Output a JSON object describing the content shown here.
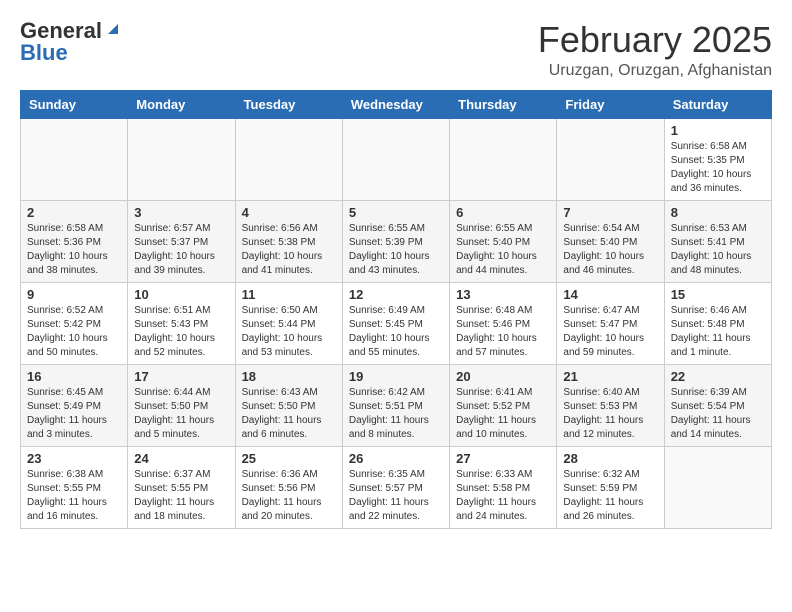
{
  "header": {
    "logo_general": "General",
    "logo_blue": "Blue",
    "month": "February 2025",
    "location": "Uruzgan, Oruzgan, Afghanistan"
  },
  "days_of_week": [
    "Sunday",
    "Monday",
    "Tuesday",
    "Wednesday",
    "Thursday",
    "Friday",
    "Saturday"
  ],
  "weeks": [
    [
      {
        "day": "",
        "info": ""
      },
      {
        "day": "",
        "info": ""
      },
      {
        "day": "",
        "info": ""
      },
      {
        "day": "",
        "info": ""
      },
      {
        "day": "",
        "info": ""
      },
      {
        "day": "",
        "info": ""
      },
      {
        "day": "1",
        "info": "Sunrise: 6:58 AM\nSunset: 5:35 PM\nDaylight: 10 hours\nand 36 minutes."
      }
    ],
    [
      {
        "day": "2",
        "info": "Sunrise: 6:58 AM\nSunset: 5:36 PM\nDaylight: 10 hours\nand 38 minutes."
      },
      {
        "day": "3",
        "info": "Sunrise: 6:57 AM\nSunset: 5:37 PM\nDaylight: 10 hours\nand 39 minutes."
      },
      {
        "day": "4",
        "info": "Sunrise: 6:56 AM\nSunset: 5:38 PM\nDaylight: 10 hours\nand 41 minutes."
      },
      {
        "day": "5",
        "info": "Sunrise: 6:55 AM\nSunset: 5:39 PM\nDaylight: 10 hours\nand 43 minutes."
      },
      {
        "day": "6",
        "info": "Sunrise: 6:55 AM\nSunset: 5:40 PM\nDaylight: 10 hours\nand 44 minutes."
      },
      {
        "day": "7",
        "info": "Sunrise: 6:54 AM\nSunset: 5:40 PM\nDaylight: 10 hours\nand 46 minutes."
      },
      {
        "day": "8",
        "info": "Sunrise: 6:53 AM\nSunset: 5:41 PM\nDaylight: 10 hours\nand 48 minutes."
      }
    ],
    [
      {
        "day": "9",
        "info": "Sunrise: 6:52 AM\nSunset: 5:42 PM\nDaylight: 10 hours\nand 50 minutes."
      },
      {
        "day": "10",
        "info": "Sunrise: 6:51 AM\nSunset: 5:43 PM\nDaylight: 10 hours\nand 52 minutes."
      },
      {
        "day": "11",
        "info": "Sunrise: 6:50 AM\nSunset: 5:44 PM\nDaylight: 10 hours\nand 53 minutes."
      },
      {
        "day": "12",
        "info": "Sunrise: 6:49 AM\nSunset: 5:45 PM\nDaylight: 10 hours\nand 55 minutes."
      },
      {
        "day": "13",
        "info": "Sunrise: 6:48 AM\nSunset: 5:46 PM\nDaylight: 10 hours\nand 57 minutes."
      },
      {
        "day": "14",
        "info": "Sunrise: 6:47 AM\nSunset: 5:47 PM\nDaylight: 10 hours\nand 59 minutes."
      },
      {
        "day": "15",
        "info": "Sunrise: 6:46 AM\nSunset: 5:48 PM\nDaylight: 11 hours\nand 1 minute."
      }
    ],
    [
      {
        "day": "16",
        "info": "Sunrise: 6:45 AM\nSunset: 5:49 PM\nDaylight: 11 hours\nand 3 minutes."
      },
      {
        "day": "17",
        "info": "Sunrise: 6:44 AM\nSunset: 5:50 PM\nDaylight: 11 hours\nand 5 minutes."
      },
      {
        "day": "18",
        "info": "Sunrise: 6:43 AM\nSunset: 5:50 PM\nDaylight: 11 hours\nand 6 minutes."
      },
      {
        "day": "19",
        "info": "Sunrise: 6:42 AM\nSunset: 5:51 PM\nDaylight: 11 hours\nand 8 minutes."
      },
      {
        "day": "20",
        "info": "Sunrise: 6:41 AM\nSunset: 5:52 PM\nDaylight: 11 hours\nand 10 minutes."
      },
      {
        "day": "21",
        "info": "Sunrise: 6:40 AM\nSunset: 5:53 PM\nDaylight: 11 hours\nand 12 minutes."
      },
      {
        "day": "22",
        "info": "Sunrise: 6:39 AM\nSunset: 5:54 PM\nDaylight: 11 hours\nand 14 minutes."
      }
    ],
    [
      {
        "day": "23",
        "info": "Sunrise: 6:38 AM\nSunset: 5:55 PM\nDaylight: 11 hours\nand 16 minutes."
      },
      {
        "day": "24",
        "info": "Sunrise: 6:37 AM\nSunset: 5:55 PM\nDaylight: 11 hours\nand 18 minutes."
      },
      {
        "day": "25",
        "info": "Sunrise: 6:36 AM\nSunset: 5:56 PM\nDaylight: 11 hours\nand 20 minutes."
      },
      {
        "day": "26",
        "info": "Sunrise: 6:35 AM\nSunset: 5:57 PM\nDaylight: 11 hours\nand 22 minutes."
      },
      {
        "day": "27",
        "info": "Sunrise: 6:33 AM\nSunset: 5:58 PM\nDaylight: 11 hours\nand 24 minutes."
      },
      {
        "day": "28",
        "info": "Sunrise: 6:32 AM\nSunset: 5:59 PM\nDaylight: 11 hours\nand 26 minutes."
      },
      {
        "day": "",
        "info": ""
      }
    ]
  ]
}
